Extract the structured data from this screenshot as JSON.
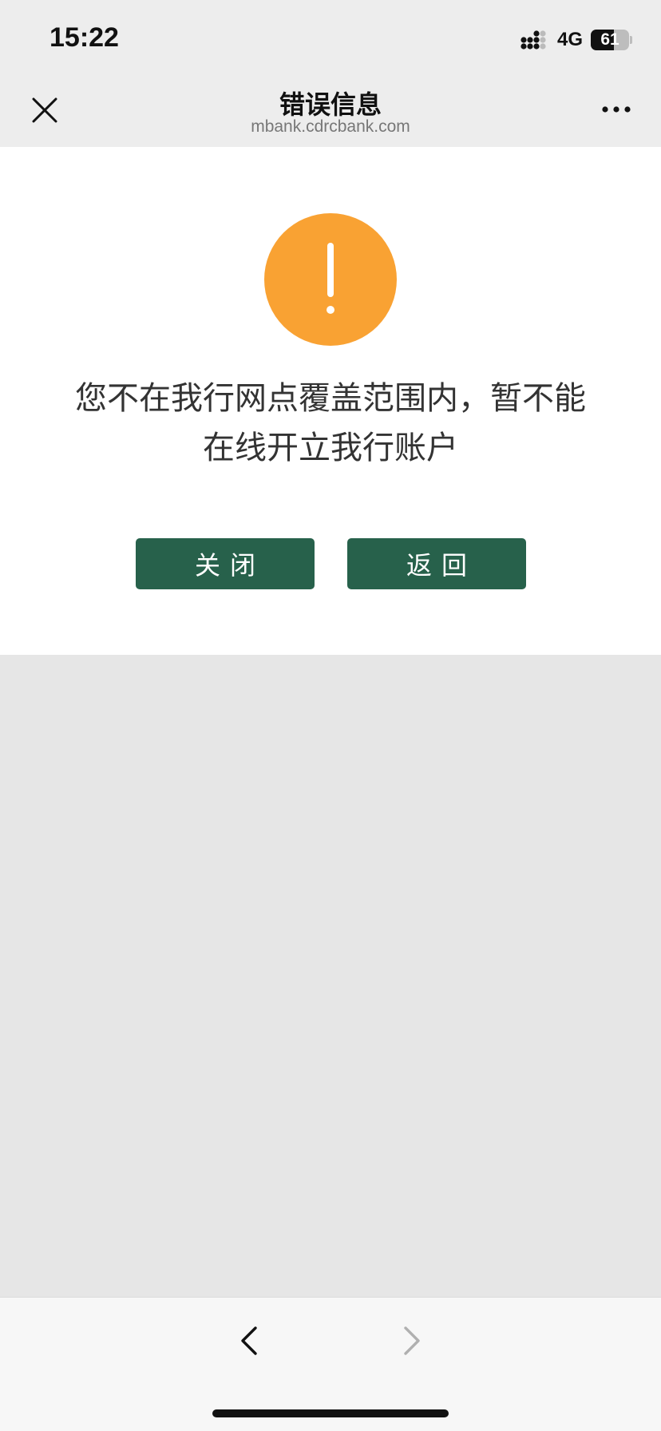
{
  "status_bar": {
    "time": "15:22",
    "network": "4G",
    "battery_level": "61",
    "battery_fraction": 0.61,
    "icons": [
      "signal-icon",
      "battery-icon"
    ]
  },
  "nav": {
    "title": "错误信息",
    "subtitle": "mbank.cdrcbank.com",
    "icons": [
      "close-icon",
      "more-icon"
    ]
  },
  "content": {
    "icon": "warning-icon",
    "message": "您不在我行网点覆盖范围内，暂不能在线开立我行账户",
    "close_label": "关闭",
    "back_label": "返回"
  },
  "bottom_bar": {
    "icons": [
      "back-arrow-icon",
      "forward-arrow-icon"
    ]
  },
  "colors": {
    "accent_button": "#27614b",
    "warning": "#f9a233",
    "nav_background": "#ededed",
    "page_background": "#e6e6e6"
  }
}
